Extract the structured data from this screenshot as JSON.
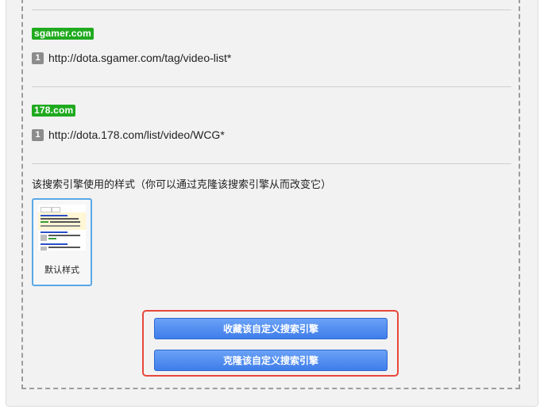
{
  "sites": [
    {
      "tag": "sgamer.com",
      "index": "1",
      "url": "http://dota.sgamer.com/tag/video-list*"
    },
    {
      "tag": "178.com",
      "index": "1",
      "url": "http://dota.178.com/list/video/WCG*"
    }
  ],
  "style_section": {
    "description": "该搜索引擎使用的样式（你可以通过克隆该搜索引擎从而改变它）",
    "style_name": "默认样式"
  },
  "buttons": {
    "collect": "收藏该自定义搜索引擎",
    "clone": "克隆该自定义搜索引擎"
  },
  "colors": {
    "tag_green": "#1faa1f",
    "button_blue": "#3f7de9",
    "highlight_red": "#e8463a",
    "selected_border": "#5aa9e6"
  }
}
